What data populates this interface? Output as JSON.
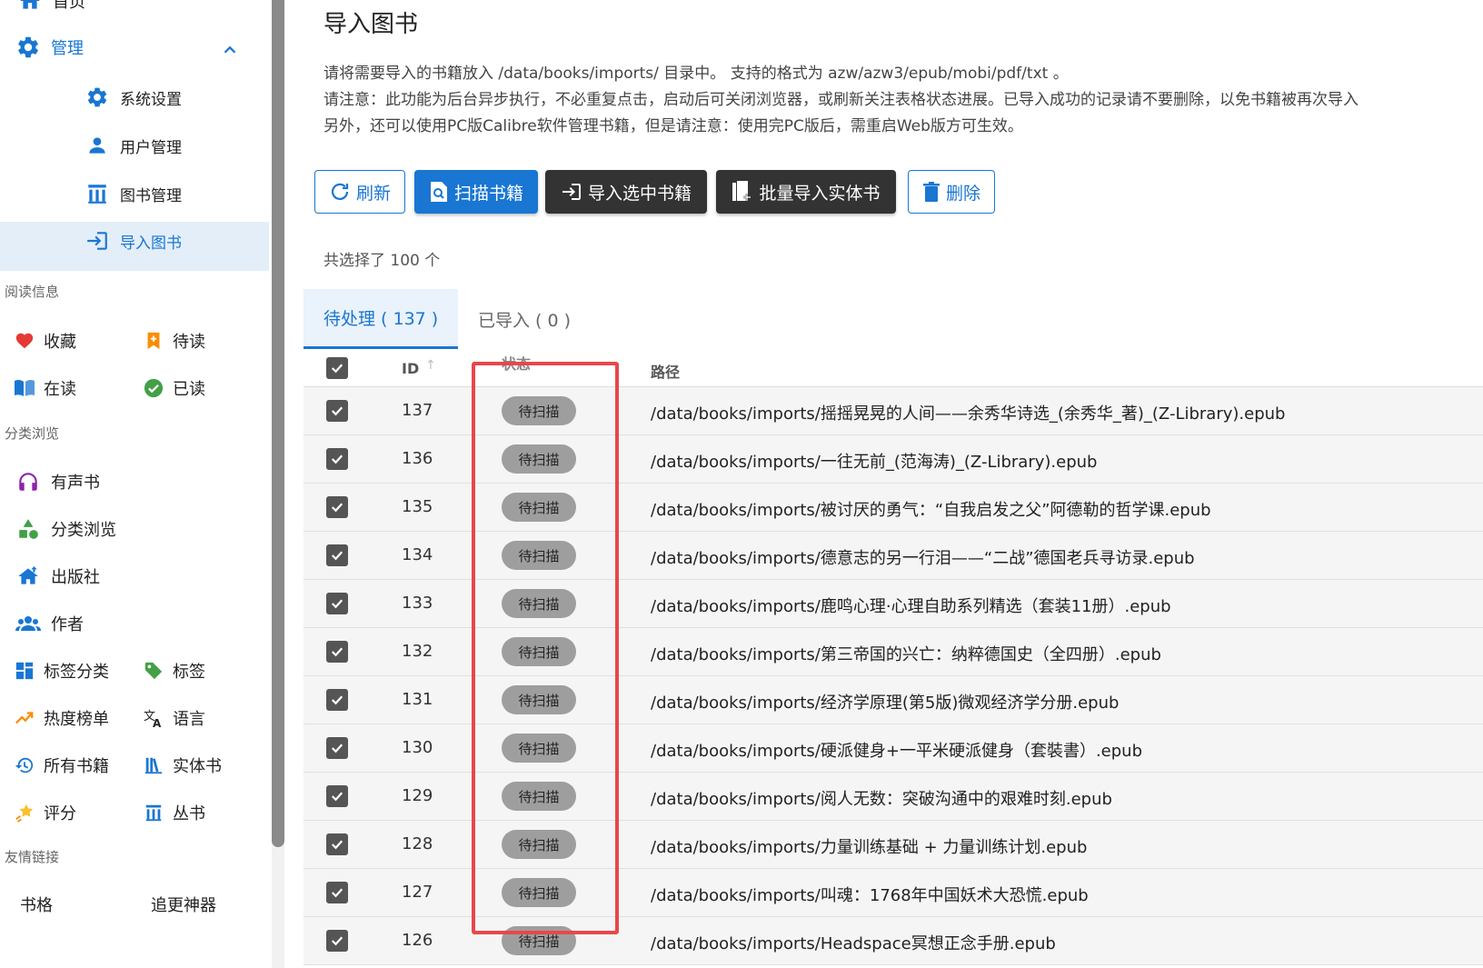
{
  "sidebar": {
    "home_label": "首页",
    "manage_label": "管理",
    "manage_items": [
      "系统设置",
      "用户管理",
      "图书管理",
      "导入图书"
    ],
    "section_reading": "阅读信息",
    "reading": [
      {
        "label": "收藏",
        "icon": "heart-icon",
        "color": "#e53935"
      },
      {
        "label": "待读",
        "icon": "bookmark-icon",
        "color": "#fb8c00"
      },
      {
        "label": "在读",
        "icon": "open-book-icon",
        "color": "#1976d2"
      },
      {
        "label": "已读",
        "icon": "check-circle-icon",
        "color": "#43a047"
      }
    ],
    "section_browse": "分类浏览",
    "browse_single": [
      "有声书",
      "分类浏览",
      "出版社",
      "作者"
    ],
    "browse_pairs": [
      [
        "标签分类",
        "标签"
      ],
      [
        "热度榜单",
        "语言"
      ],
      [
        "所有书籍",
        "实体书"
      ],
      [
        "评分",
        "丛书"
      ]
    ],
    "section_links": "友情链接",
    "links": [
      "书格",
      "追更神器"
    ]
  },
  "main": {
    "title": "导入图书",
    "desc_line1": "请将需要导入的书籍放入 /data/books/imports/ 目录中。 支持的格式为 azw/azw3/epub/mobi/pdf/txt 。",
    "desc_line2": "请注意：此功能为后台异步执行，不必重复点击，启动后可关闭浏览器，或刷新关注表格状态进展。已导入成功的记录请不要删除，以免书籍被再次导入",
    "desc_line3": "另外，还可以使用PC版Calibre软件管理书籍，但是请注意：使用完PC版后，需重启Web版方可生效。",
    "buttons": {
      "refresh": "刷新",
      "scan": "扫描书籍",
      "import_selected": "导入选中书籍",
      "batch_import": "批量导入实体书",
      "delete": "删除"
    },
    "selected_count": "共选择了 100 个",
    "tabs": {
      "pending": "待处理 ( 137 )",
      "imported": "已导入 ( 0 )"
    },
    "table": {
      "headers": {
        "id": "ID",
        "status": "状态",
        "path": "路径"
      },
      "rows": [
        {
          "id": "137",
          "status": "待扫描",
          "path": "/data/books/imports/摇摇晃晃的人间——余秀华诗选_(余秀华_著)_(Z-Library).epub"
        },
        {
          "id": "136",
          "status": "待扫描",
          "path": "/data/books/imports/一往无前_(范海涛)_(Z-Library).epub"
        },
        {
          "id": "135",
          "status": "待扫描",
          "path": "/data/books/imports/被讨厌的勇气：“自我启发之父”阿德勒的哲学课.epub"
        },
        {
          "id": "134",
          "status": "待扫描",
          "path": "/data/books/imports/德意志的另一行泪——“二战”德国老兵寻访录.epub"
        },
        {
          "id": "133",
          "status": "待扫描",
          "path": "/data/books/imports/鹿鸣心理·心理自助系列精选（套装11册）.epub"
        },
        {
          "id": "132",
          "status": "待扫描",
          "path": "/data/books/imports/第三帝国的兴亡：纳粹德国史（全四册）.epub"
        },
        {
          "id": "131",
          "status": "待扫描",
          "path": "/data/books/imports/经济学原理(第5版)微观经济学分册.epub"
        },
        {
          "id": "130",
          "status": "待扫描",
          "path": "/data/books/imports/硬派健身+一平米硬派健身（套裝書）.epub"
        },
        {
          "id": "129",
          "status": "待扫描",
          "path": "/data/books/imports/阅人无数：突破沟通中的艰难时刻.epub"
        },
        {
          "id": "128",
          "status": "待扫描",
          "path": "/data/books/imports/力量训练基础 + 力量训练计划.epub"
        },
        {
          "id": "127",
          "status": "待扫描",
          "path": "/data/books/imports/叫魂：1768年中国妖术大恐慌.epub"
        },
        {
          "id": "126",
          "status": "待扫描",
          "path": "/data/books/imports/Headspace冥想正念手册.epub"
        }
      ]
    }
  }
}
